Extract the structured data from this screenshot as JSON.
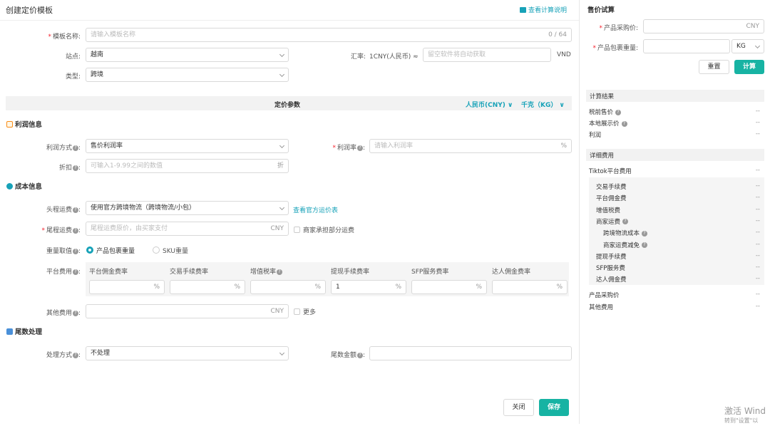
{
  "page": {
    "title": "创建定价模板",
    "calc_link": "查看计算说明"
  },
  "form": {
    "name_label": "模板名称:",
    "name_placeholder": "请输入模板名称",
    "name_count": "0 / 64",
    "site_label": "站点:",
    "site_value": "越南",
    "rate_label": "汇率:",
    "rate_value": "1CNY(人民币) ≈",
    "rate_placeholder": "留空软件将自动获取",
    "rate_unit": "VND",
    "type_label": "类型:",
    "type_value": "跨境"
  },
  "params_bar": {
    "title": "定价参数",
    "currency": "人民币(CNY)",
    "weight_unit": "千克（KG）"
  },
  "profit": {
    "section": "利润信息",
    "method_label": "利润方式",
    "method_value": "售价利润率",
    "rate_label": "利润率",
    "rate_placeholder": "请输入利润率",
    "rate_unit": "%",
    "discount_label": "折扣",
    "discount_placeholder": "可输入1-9.99之间的数值",
    "discount_unit": "折"
  },
  "cost": {
    "section": "成本信息",
    "first_leg_label": "头程运费",
    "first_leg_value": "使用官方跨境物流（跨境物流/小包）",
    "first_leg_link": "查看官方运价表",
    "last_leg_label": "尾程运费",
    "last_leg_placeholder": "尾程运费原价，由买家支付",
    "last_leg_unit": "CNY",
    "last_leg_check": "商家承担部分运费",
    "weight_label": "重量取值",
    "weight_opt1": "产品包裹重量",
    "weight_opt2": "SKU重量",
    "platform_label": "平台费用",
    "platform_cols": [
      "平台佣金费率",
      "交易手续费率",
      "增值税率",
      "提现手续费率",
      "SFP服务费率",
      "达人佣金费率"
    ],
    "platform_values": [
      "",
      "",
      "",
      "1",
      "",
      ""
    ],
    "platform_unit": "%",
    "other_label": "其他费用",
    "other_unit": "CNY",
    "other_more": "更多"
  },
  "rounding": {
    "section": "尾数处理",
    "method_label": "处理方式",
    "method_value": "不处理",
    "amount_label": "尾数金额"
  },
  "actions": {
    "close": "关闭",
    "save": "保存"
  },
  "calc": {
    "title": "售价试算",
    "purchase_label": "产品采购价:",
    "purchase_unit": "CNY",
    "weight_label": "产品包裹重量:",
    "weight_unit": "KG",
    "reset": "重置",
    "compute": "计算",
    "result_header": "计算结果",
    "results": [
      {
        "label": "税前售价",
        "value": "--"
      },
      {
        "label": "本地展示价",
        "value": "--"
      },
      {
        "label": "利润",
        "value": "--"
      }
    ],
    "detail_header": "详细费用",
    "tiktok_label": "Tiktok平台费用",
    "tiktok_value": "--",
    "detail_items": [
      {
        "label": "交易手续费",
        "value": "--"
      },
      {
        "label": "平台佣金费",
        "value": "--"
      },
      {
        "label": "增值税费",
        "value": "--"
      },
      {
        "label": "商家运费",
        "value": "--"
      },
      {
        "label": "跨境物流成本",
        "value": "--"
      },
      {
        "label": "商家运费减免",
        "value": "--"
      },
      {
        "label": "提现手续费",
        "value": "--"
      },
      {
        "label": "SFP服务费",
        "value": "--"
      },
      {
        "label": "达人佣金费",
        "value": "--"
      }
    ],
    "purchase_row": "产品采购价",
    "purchase_value": "--",
    "other_row": "其他费用",
    "other_value": "--"
  },
  "watermark": {
    "line1": "激活 Wind",
    "line2": "转到\"设置\"以"
  }
}
